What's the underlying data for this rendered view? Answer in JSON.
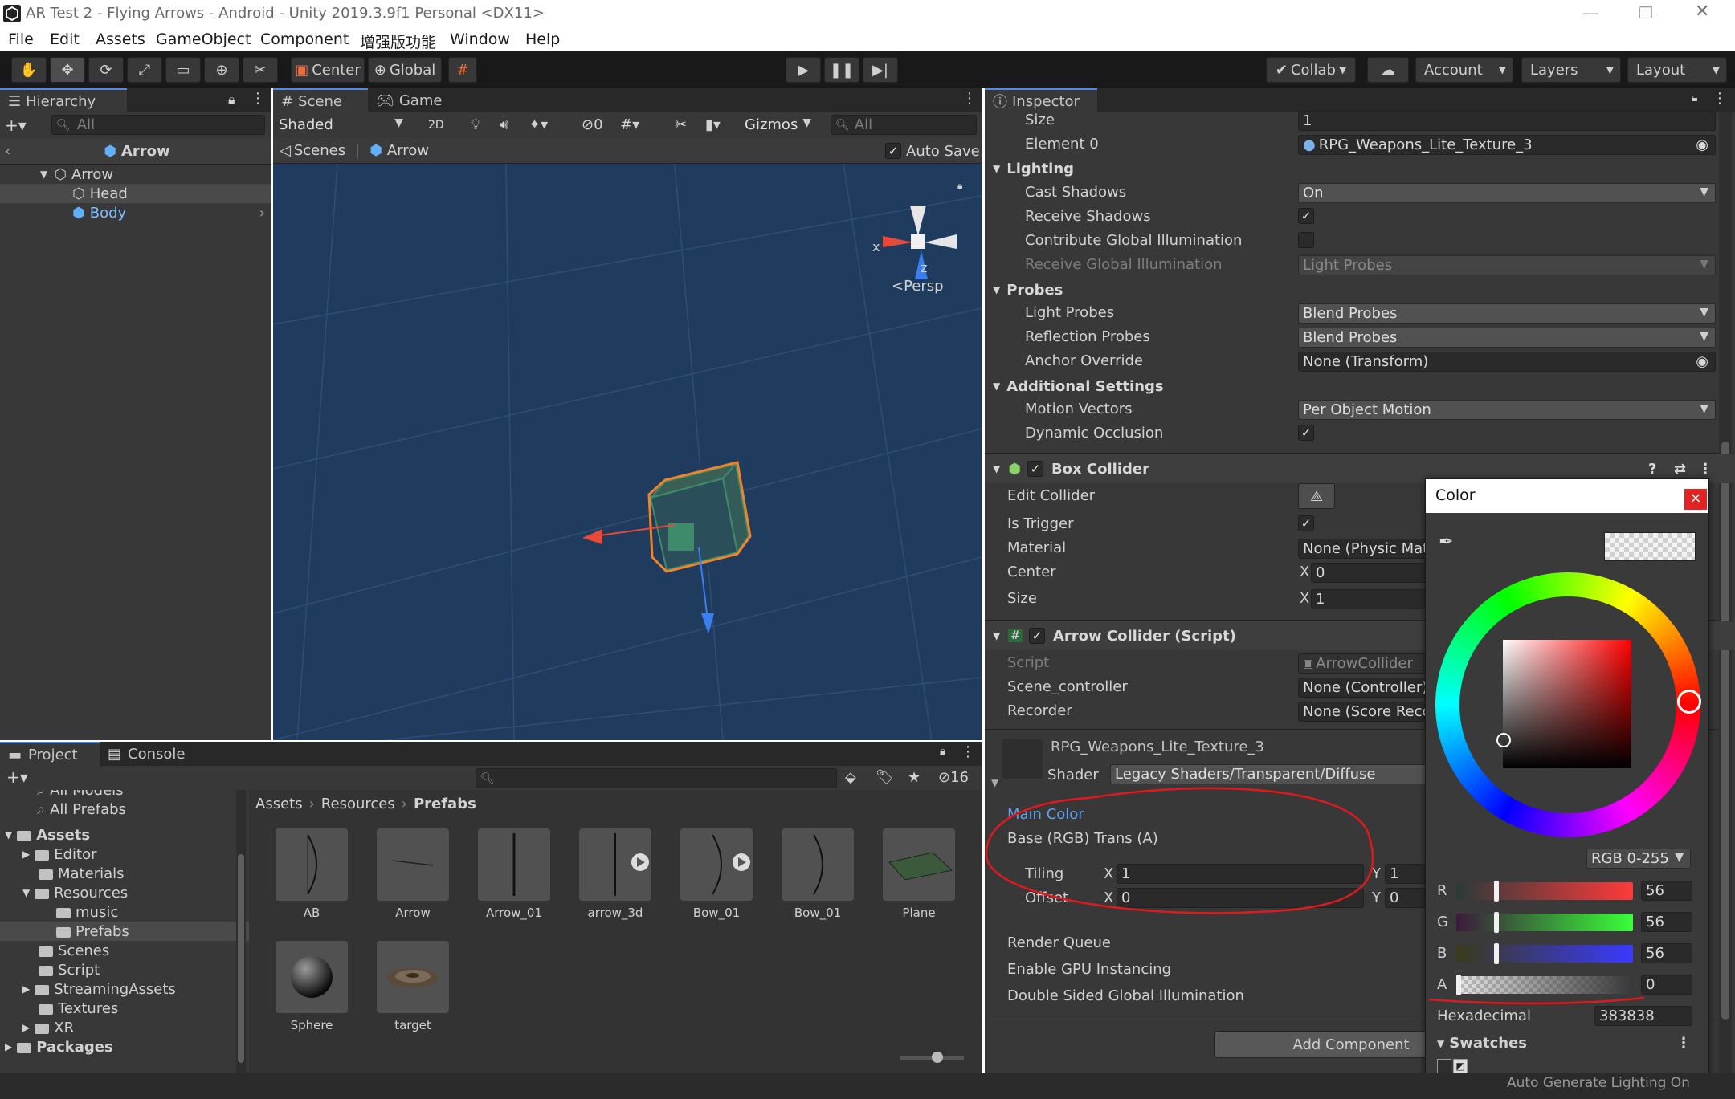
{
  "window": {
    "title": "AR Test 2 - Flying Arrows - Android - Unity 2019.3.9f1 Personal <DX11>",
    "minimize": "—",
    "maximize": "❐",
    "close": "✕"
  },
  "menu": [
    "File",
    "Edit",
    "Assets",
    "GameObject",
    "Component",
    "增强版功能",
    "Window",
    "Help"
  ],
  "toolbar": {
    "pivot": "Center",
    "space": "Global",
    "collab": "Collab",
    "account": "Account",
    "layers": "Layers",
    "layout": "Layout"
  },
  "hierarchy": {
    "tab": "Hierarchy",
    "search_placeholder": "All",
    "scene_title": "Arrow",
    "items": [
      {
        "label": "Arrow",
        "depth": 0
      },
      {
        "label": "Head",
        "depth": 1
      },
      {
        "label": "Body",
        "depth": 1
      }
    ]
  },
  "scene": {
    "tabs": [
      "Scene",
      "Game"
    ],
    "shading": "Shaded",
    "mode_2d": "2D",
    "fx_count": "0",
    "gizmos": "Gizmos",
    "search_placeholder": "All",
    "breadcrumb": [
      "Scenes",
      "Arrow"
    ],
    "auto_save": "Auto Save",
    "axis_x": "x",
    "axis_z": "z",
    "persp": "Persp"
  },
  "project": {
    "tabs": [
      "Project",
      "Console"
    ],
    "hidden_count": "16",
    "favorites": [
      "All Models",
      "All Prefabs"
    ],
    "tree": [
      {
        "label": "Assets",
        "depth": 0,
        "bold": true
      },
      {
        "label": "Editor",
        "depth": 1
      },
      {
        "label": "Materials",
        "depth": 1
      },
      {
        "label": "Resources",
        "depth": 1
      },
      {
        "label": "music",
        "depth": 2
      },
      {
        "label": "Prefabs",
        "depth": 2
      },
      {
        "label": "Scenes",
        "depth": 1
      },
      {
        "label": "Script",
        "depth": 1
      },
      {
        "label": "StreamingAssets",
        "depth": 1
      },
      {
        "label": "Textures",
        "depth": 1
      },
      {
        "label": "XR",
        "depth": 1
      },
      {
        "label": "Packages",
        "depth": 0,
        "bold": true
      }
    ],
    "breadcrumb": [
      "Assets",
      "Resources",
      "Prefabs"
    ],
    "assets": [
      "AB",
      "Arrow",
      "Arrow_01",
      "arrow_3d",
      "Bow_01",
      "Bow_01",
      "Plane",
      "Sphere",
      "target"
    ]
  },
  "inspector": {
    "tab": "Inspector",
    "size_label": "Size",
    "size_value": "1",
    "element0_label": "Element 0",
    "element0_value": "RPG_Weapons_Lite_Texture_3",
    "lighting": {
      "title": "Lighting",
      "cast_shadows_label": "Cast Shadows",
      "cast_shadows_value": "On",
      "receive_shadows_label": "Receive Shadows",
      "contribute_gi_label": "Contribute Global Illumination",
      "receive_gi_label": "Receive Global Illumination",
      "receive_gi_value": "Light Probes"
    },
    "probes": {
      "title": "Probes",
      "light_probes_label": "Light Probes",
      "light_probes_value": "Blend Probes",
      "reflection_probes_label": "Reflection Probes",
      "reflection_probes_value": "Blend Probes",
      "anchor_label": "Anchor Override",
      "anchor_value": "None (Transform)"
    },
    "additional": {
      "title": "Additional Settings",
      "motion_vectors_label": "Motion Vectors",
      "motion_vectors_value": "Per Object Motion",
      "dynamic_occlusion_label": "Dynamic Occlusion"
    },
    "box_collider": {
      "title": "Box Collider",
      "edit_collider": "Edit Collider",
      "is_trigger": "Is Trigger",
      "material_label": "Material",
      "material_value": "None (Physic Mat",
      "center_label": "Center",
      "center_x": "0",
      "size_label": "Size",
      "size_x": "1",
      "axis_x": "X"
    },
    "arrow_collider": {
      "title": "Arrow Collider (Script)",
      "script_label": "Script",
      "script_value": "ArrowCollider",
      "scene_controller_label": "Scene_controller",
      "scene_controller_value": "None (Controller)",
      "recorder_label": "Recorder",
      "recorder_value": "None (Score Reco"
    },
    "material": {
      "name": "RPG_Weapons_Lite_Texture_3",
      "shader_label": "Shader",
      "shader_value": "Legacy Shaders/Transparent/Diffuse",
      "main_color": "Main Color",
      "base_label": "Base (RGB) Trans (A)",
      "tiling_label": "Tiling",
      "offset_label": "Offset",
      "tiling_x": "1",
      "tiling_y": "1",
      "offset_x": "0",
      "offset_y": "0",
      "axis_x": "X",
      "axis_y": "Y",
      "render_queue": "Render Queue",
      "gpu_instancing": "Enable GPU Instancing",
      "double_sided_gi": "Double Sided Global Illumination"
    },
    "add_component": "Add Component"
  },
  "color_picker": {
    "title": "Color",
    "close": "×",
    "mode": "RGB 0-255",
    "channels": [
      {
        "label": "R",
        "value": "56",
        "fraction": 0.22
      },
      {
        "label": "G",
        "value": "56",
        "fraction": 0.22
      },
      {
        "label": "B",
        "value": "56",
        "fraction": 0.22
      },
      {
        "label": "A",
        "value": "0",
        "fraction": 0.0
      }
    ],
    "hex_label": "Hexadecimal",
    "hex_value": "383838",
    "swatches": "Swatches"
  },
  "statusbar": {
    "text": "Auto Generate Lighting On"
  },
  "colors": {
    "accent": "#4a8af4",
    "selection": "#2c5d87",
    "annotation": "#e0191f",
    "viewport_bg": "#1e3a5c"
  }
}
